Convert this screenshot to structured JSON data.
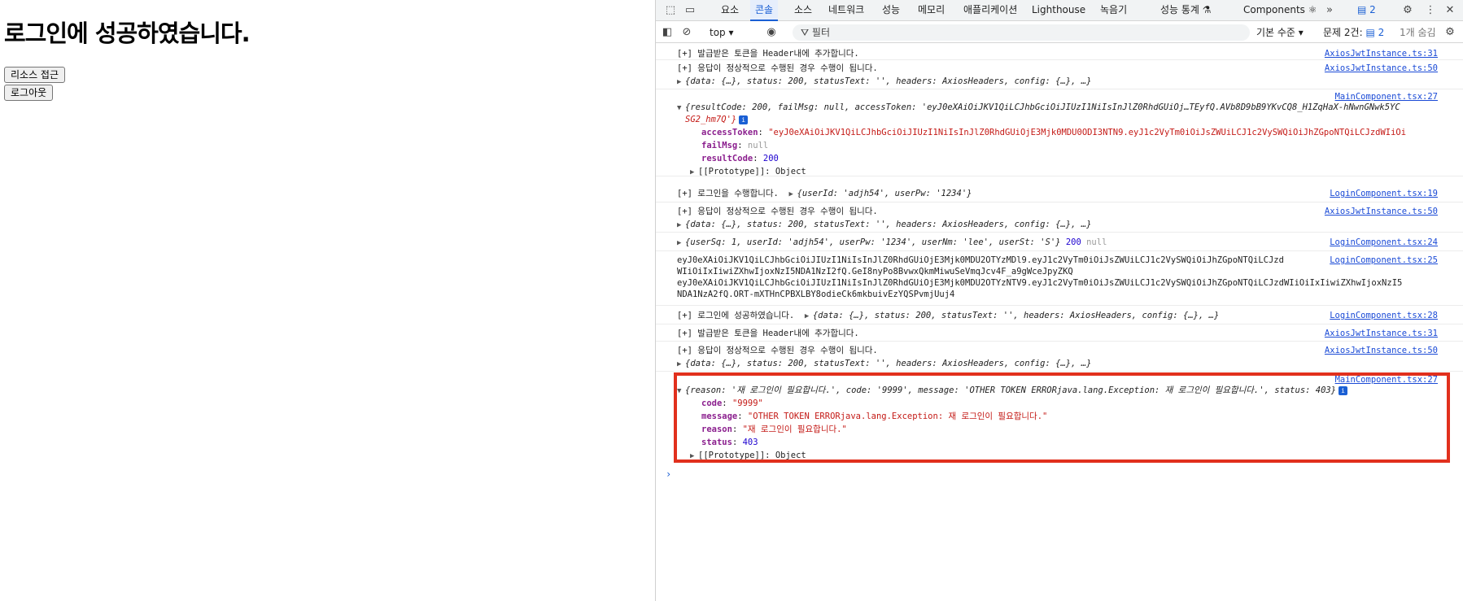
{
  "page": {
    "heading": "로그인에 성공하였습니다.",
    "resource_button": "리소스 접근",
    "logout_button": "로그아웃"
  },
  "devtools": {
    "tabs": [
      "요소",
      "콘솔",
      "소스",
      "네트워크",
      "성능",
      "메모리",
      "애플리케이션",
      "Lighthouse",
      "녹음기",
      "성능 통계 ⚗",
      "Components ⚛"
    ],
    "active_tab": "콘솔",
    "issues_count": "2",
    "toolbar": {
      "context": "top",
      "filter_placeholder": "필터",
      "levels": "기본 수준",
      "issues_label": "문제 2건:",
      "issues_count": "2",
      "hidden": "1개 숨김"
    },
    "messages": {
      "m1": {
        "text": "[+] 발급받은 토큰을 Header내에 추가합니다.",
        "src": "AxiosJwtInstance.ts:31"
      },
      "m2": {
        "text": "[+] 응답이 정상적으로 수행된 경우 수행이 됩니다.",
        "src": "AxiosJwtInstance.ts:50",
        "obj": "{data: {…}, status: 200, statusText: '', headers: AxiosHeaders, config: {…}, …}"
      },
      "m3": {
        "src": "MainComponent.tsx:27",
        "summary1": "{resultCode: 200, failMsg: null, accessToken: 'eyJ0eXAiOiJKV1QiLCJhbGciOiJIUzI1NiIsInJlZ0RhdGUiOj…TEyfQ.AVb8D9bB9YKvCQ8_H1ZqHaX-hNwnGNwk5YC",
        "summary2": "SG2_hm7Q'}",
        "accessToken_key": "accessToken",
        "accessToken_val": "\"eyJ0eXAiOiJKV1QiLCJhbGciOiJIUzI1NiIsInJlZ0RhdGUiOjE3Mjk0MDU0ODI3NTN9.eyJ1c2VyTm0iOiJsZWUiLCJ1c2VySWQiOiJhZGpoNTQiLCJzdWIiOi",
        "failMsg_key": "failMsg",
        "failMsg_val": "null",
        "resultCode_key": "resultCode",
        "resultCode_val": "200",
        "proto": "[[Prototype]]: Object"
      },
      "m4": {
        "text": "[+] 로그인을 수행합니다.",
        "obj": "{userId: 'adjh54', userPw: '1234'}",
        "src": "LoginComponent.tsx:19"
      },
      "m5": {
        "text": "[+] 응답이 정상적으로 수행된 경우 수행이 됩니다.",
        "src": "AxiosJwtInstance.ts:50",
        "obj": "{data: {…}, status: 200, statusText: '', headers: AxiosHeaders, config: {…}, …}"
      },
      "m6": {
        "obj": "{userSq: 1, userId: 'adjh54', userPw: '1234', userNm: 'lee', userSt: 'S'}",
        "status": "200",
        "nullv": "null",
        "src": "LoginComponent.tsx:24"
      },
      "m7": {
        "l1": "eyJ0eXAiOiJKV1QiLCJhbGciOiJIUzI1NiIsInJlZ0RhdGUiOjE3Mjk0MDU2OTYzMDl9.eyJ1c2VyTm0iOiJsZWUiLCJ1c2VySWQiOiJhZGpoNTQiLCJzd",
        "l2": "WIiOiIxIiwiZXhwIjoxNzI5NDA1NzI2fQ.GeI8nyPo8BvwxQkmMiwuSeVmqJcv4F_a9gWceJpyZKQ",
        "l3": "eyJ0eXAiOiJKV1QiLCJhbGciOiJIUzI1NiIsInJlZ0RhdGUiOjE3Mjk0MDU2OTYzNTV9.eyJ1c2VyTm0iOiJsZWUiLCJ1c2VySWQiOiJhZGpoNTQiLCJzdWIiOiIxIiwiZXhwIjoxNzI5",
        "l4": "NDA1NzA2fQ.ORT-mXTHnCPBXLBY8odieCk6mkbuivEzYQSPvmjUuj4",
        "src": "LoginComponent.tsx:25"
      },
      "m8": {
        "text": "[+] 로그인에 성공하였습니다.",
        "obj": "{data: {…}, status: 200, statusText: '', headers: AxiosHeaders, config: {…}, …}",
        "src": "LoginComponent.tsx:28"
      },
      "m9": {
        "text": "[+] 발급받은 토큰을 Header내에 추가합니다.",
        "src": "AxiosJwtInstance.ts:31"
      },
      "m10": {
        "text": "[+] 응답이 정상적으로 수행된 경우 수행이 됩니다.",
        "src": "AxiosJwtInstance.ts:50",
        "obj": "{data: {…}, status: 200, statusText: '', headers: AxiosHeaders, config: {…}, …}"
      },
      "m11": {
        "src": "MainComponent.tsx:27",
        "summary": "{reason: '재 로그인이 필요합니다.', code: '9999', message: 'OTHER TOKEN ERRORjava.lang.Exception: 재 로그인이 필요합니다.', status: 403}",
        "code_key": "code",
        "code_val": "\"9999\"",
        "message_key": "message",
        "message_val": "\"OTHER TOKEN ERRORjava.lang.Exception: 재 로그인이 필요합니다.\"",
        "reason_key": "reason",
        "reason_val": "\"재 로그인이 필요합니다.\"",
        "status_key": "status",
        "status_val": "403",
        "proto": "[[Prototype]]: Object"
      }
    },
    "prompt": "›"
  },
  "colors": {
    "highlight": "#e1301d",
    "link": "#1a4ad6",
    "accent": "#1a5fd4"
  }
}
